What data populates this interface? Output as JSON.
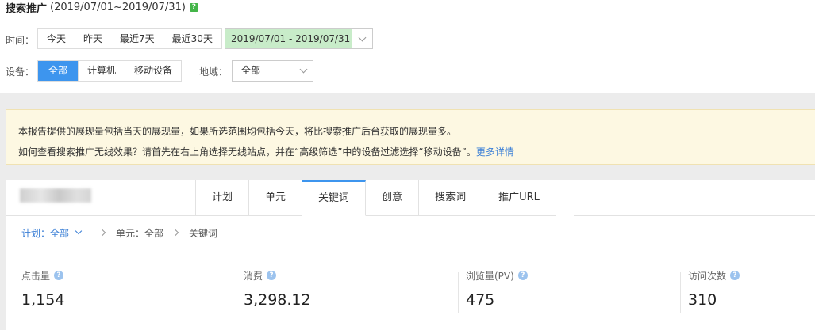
{
  "header": {
    "title": "搜索推广",
    "date_range": "(2019/07/01~2019/07/31)",
    "help_icon": "?"
  },
  "filters": {
    "time_label": "时间：",
    "quick_ranges": [
      "今天",
      "昨天",
      "最近7天",
      "最近30天"
    ],
    "date_value": "2019/07/01 - 2019/07/31",
    "device_label": "设备：",
    "devices": [
      "全部",
      "计算机",
      "移动设备"
    ],
    "device_active_index": 0,
    "region_label": "地域：",
    "region_value": "全部"
  },
  "notice": {
    "line1": "本报告提供的展现量包括当天的展现量，如果所选范围均包括今天，将比搜索推广后台获取的展现量多。",
    "line2": "如何查看搜索推广无线效果？请首先在右上角选择无线站点，并在“高级筛选”中的设备过滤选择“移动设备”。",
    "more_link": "更多详情"
  },
  "tabs": [
    "计划",
    "单元",
    "关键词",
    "创意",
    "搜索词",
    "推广URL"
  ],
  "active_tab_index": 2,
  "breadcrumb": {
    "plan": "计划：全部",
    "unit": "单元：全部",
    "current": "关键词"
  },
  "metrics": [
    {
      "label": "点击量",
      "value": "1,154"
    },
    {
      "label": "消费",
      "value": "3,298.12"
    },
    {
      "label": "浏览量(PV)",
      "value": "475"
    },
    {
      "label": "访问次数",
      "value": "310"
    }
  ],
  "colors": {
    "accent": "#3d95ee",
    "date_highlight": "#c8ecc9",
    "notice_bg": "#fdf8e2",
    "link": "#3b7fd6"
  }
}
